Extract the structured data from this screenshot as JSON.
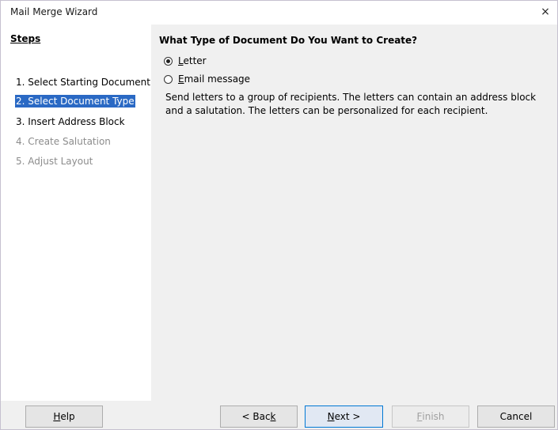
{
  "window": {
    "title": "Mail Merge Wizard",
    "close_glyph": "×"
  },
  "sidebar": {
    "heading": "Steps",
    "steps": [
      {
        "label": "1. Select Starting Document",
        "state": "normal"
      },
      {
        "label": "2. Select Document Type",
        "state": "active"
      },
      {
        "label": "3. Insert Address Block",
        "state": "normal"
      },
      {
        "label": "4. Create Salutation",
        "state": "disabled"
      },
      {
        "label": "5. Adjust Layout",
        "state": "disabled"
      }
    ]
  },
  "main": {
    "title": "What Type of Document Do You Want to Create?",
    "options": {
      "letter": {
        "mnemonic": "L",
        "rest": "etter",
        "selected": true
      },
      "email": {
        "mnemonic": "E",
        "rest": "mail message",
        "selected": false
      }
    },
    "description": "Send letters to a group of recipients. The letters can contain an address block and a salutation. The letters can be personalized for each recipient."
  },
  "buttons": {
    "help": {
      "mnemonic": "H",
      "rest": "elp"
    },
    "back": {
      "before": "< Bac",
      "mnemonic": "k"
    },
    "next": {
      "mnemonic": "N",
      "rest": "ext >"
    },
    "finish": {
      "mnemonic": "F",
      "rest": "inish",
      "enabled": false
    },
    "cancel": {
      "label": "Cancel"
    }
  },
  "colors": {
    "selection": "#2a69c4",
    "default_button_border": "#0078d4"
  }
}
